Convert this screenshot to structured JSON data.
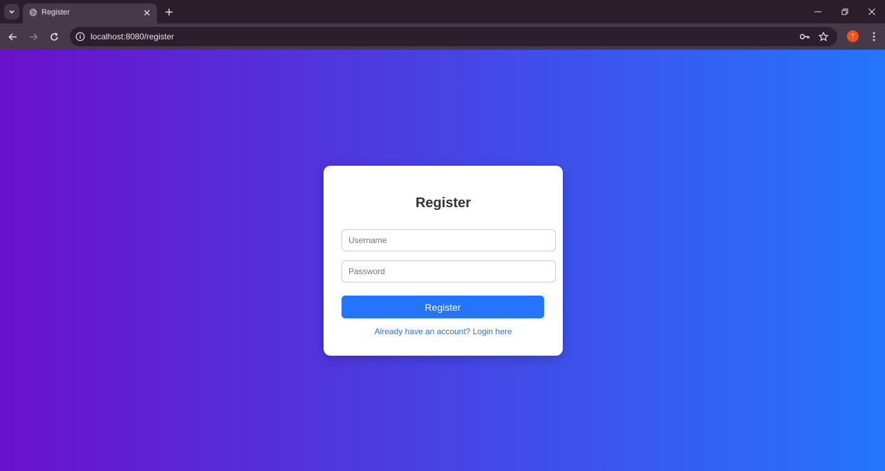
{
  "browser": {
    "tab": {
      "title": "Register"
    },
    "address_bar": {
      "url": "localhost:8080/register"
    },
    "profile": {
      "initial": "T",
      "color": "#f0521f"
    }
  },
  "page": {
    "background": {
      "from": "#6a11cb",
      "to": "#2575fc"
    },
    "form": {
      "title": "Register",
      "username_placeholder": "Username",
      "password_placeholder": "Password",
      "submit_label": "Register",
      "login_link": "Already have an account? Login here",
      "accent_color": "#2575fc"
    }
  }
}
